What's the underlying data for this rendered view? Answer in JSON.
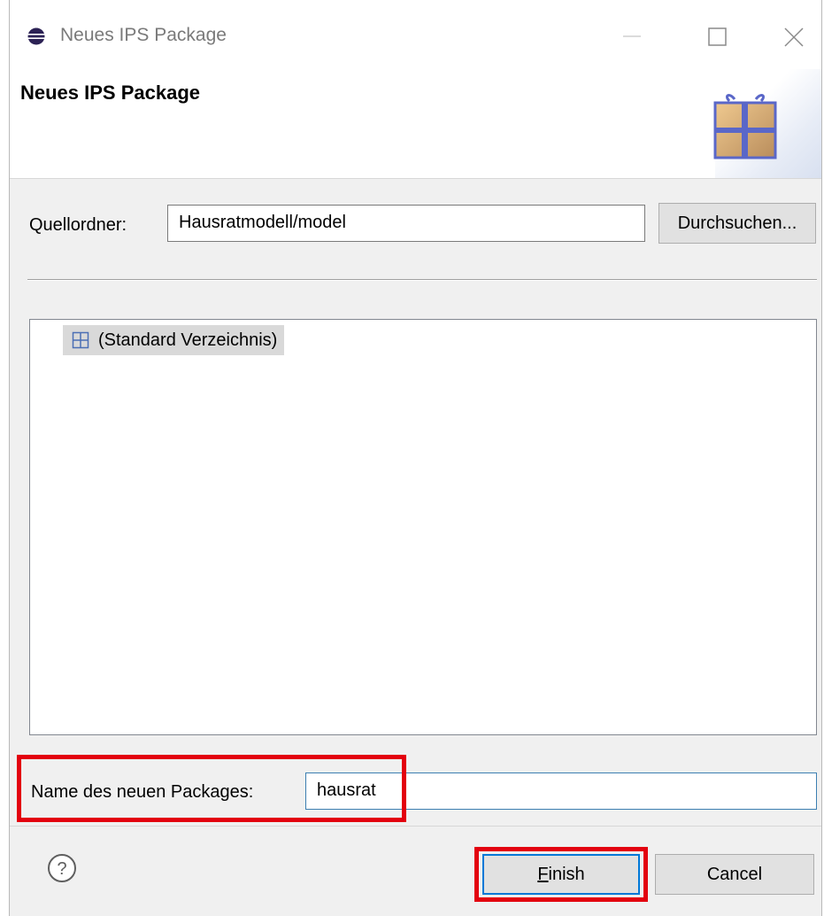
{
  "window": {
    "title": "Neues IPS Package",
    "controls": [
      "minimize-icon",
      "maximize-icon",
      "close-icon"
    ]
  },
  "banner": {
    "heading": "Neues IPS Package",
    "icon": "package-gift-icon"
  },
  "source": {
    "label": "Quellordner:",
    "value": "Hausratmodell/model",
    "browse_label": "Durchsuchen..."
  },
  "tree": {
    "items": [
      {
        "label": "(Standard Verzeichnis)",
        "icon": "default-package-icon",
        "selected": true
      }
    ]
  },
  "package": {
    "label": "Name des neuen Packages:",
    "value": "hausrat"
  },
  "buttons": {
    "help_icon": "help-icon",
    "finish_mnemonic": "F",
    "finish_rest": "inish",
    "cancel": "Cancel"
  },
  "colors": {
    "highlight": "#e3000f",
    "focus": "#0078d7"
  }
}
